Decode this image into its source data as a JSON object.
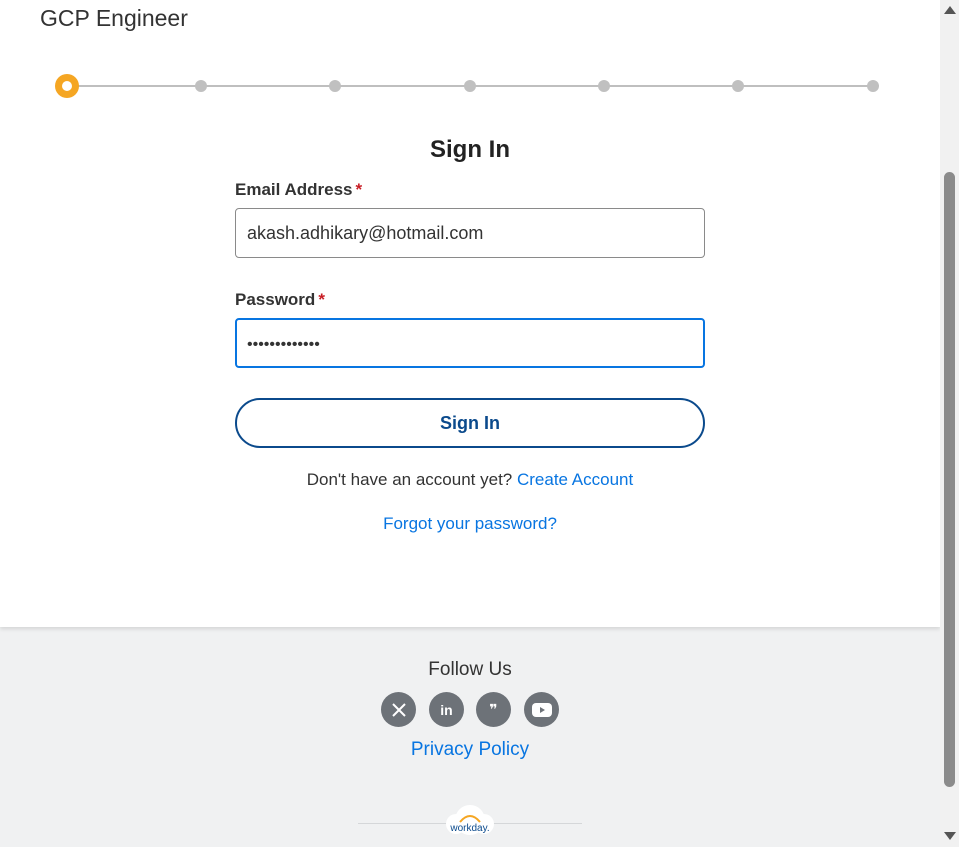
{
  "header": {
    "job_title": "GCP Engineer"
  },
  "stepper": {
    "total_steps": 7,
    "current_step": 1
  },
  "form": {
    "title": "Sign In",
    "email": {
      "label": "Email Address",
      "required_mark": "*",
      "value": "akash.adhikary@hotmail.com"
    },
    "password": {
      "label": "Password",
      "required_mark": "*",
      "masked_value": "•••••••••••••"
    },
    "submit_label": "Sign In",
    "no_account_text": "Don't have an account yet?",
    "create_account_link": "Create Account",
    "forgot_password_link": "Forgot your password?"
  },
  "footer": {
    "follow_title": "Follow Us",
    "socials": [
      {
        "name": "x-icon",
        "glyph": "𝕏"
      },
      {
        "name": "linkedin-icon",
        "glyph": "in"
      },
      {
        "name": "blog-icon",
        "glyph": "❞"
      },
      {
        "name": "youtube-icon",
        "glyph": "▶"
      }
    ],
    "privacy_link": "Privacy Policy",
    "brand": "workday."
  },
  "colors": {
    "accent": "#0875e1",
    "button_border": "#0b4a8c",
    "step_active": "#f5a623",
    "step_inactive": "#c0c0c0",
    "required": "#c81d25",
    "social_bg": "#6d7278"
  }
}
